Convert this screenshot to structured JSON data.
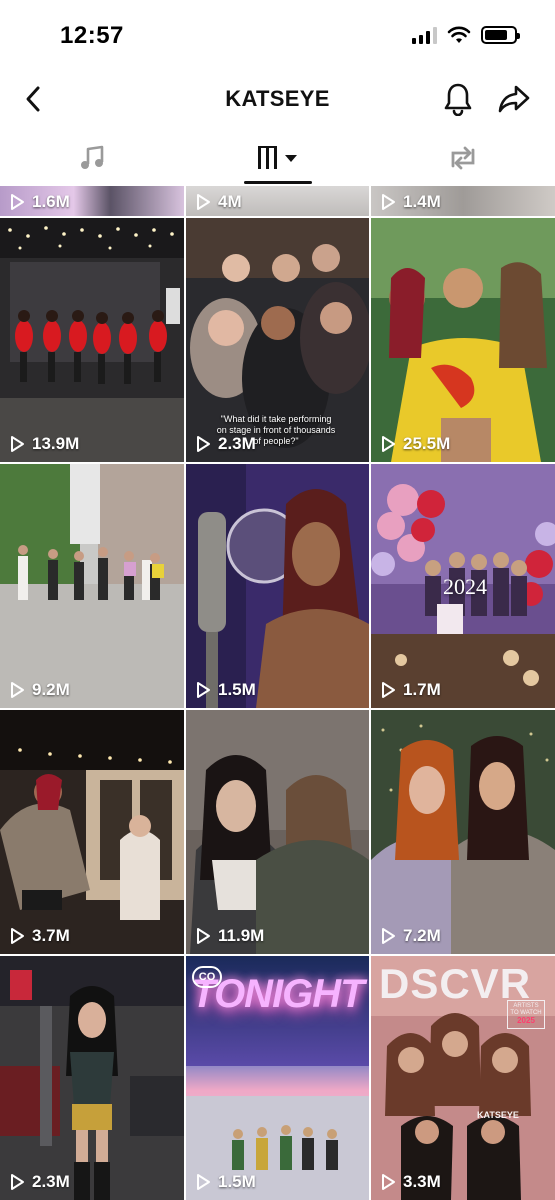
{
  "status_bar": {
    "time": "12:57",
    "battery_level": 0.8
  },
  "header": {
    "title": "KATSEYE"
  },
  "tabs": [
    {
      "icon": "music-note-icon",
      "active": false
    },
    {
      "icon": "grid-bars-icon",
      "active": true
    },
    {
      "icon": "repost-icon",
      "active": false
    }
  ],
  "videos": [
    {
      "views": "1.6M"
    },
    {
      "views": "4M"
    },
    {
      "views": "1.4M"
    },
    {
      "views": "13.9M"
    },
    {
      "views": "2.3M",
      "caption": "\"What did it take performing on stage in front of thousands of people?\""
    },
    {
      "views": "25.5M"
    },
    {
      "views": "9.2M"
    },
    {
      "views": "1.5M"
    },
    {
      "views": "1.7M",
      "overlay_text": "2024"
    },
    {
      "views": "3.7M"
    },
    {
      "views": "11.9M"
    },
    {
      "views": "7.2M"
    },
    {
      "views": "2.3M"
    },
    {
      "views": "1.5M",
      "overlay_text": "TONIGHT",
      "badge": "CO"
    },
    {
      "views": "3.3M",
      "overlay_text": "DSCVR",
      "badge_line1": "ARTISTS",
      "badge_line2": "TO WATCH",
      "badge_year": "2025",
      "tag": "KATSEYE"
    }
  ],
  "colors": {
    "text": "#111111",
    "background": "#ffffff",
    "tab_indicator": "#111111"
  }
}
